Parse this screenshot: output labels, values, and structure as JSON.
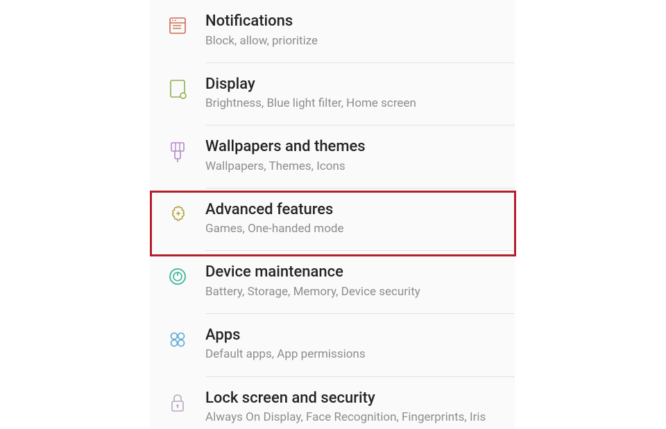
{
  "settings": {
    "items": [
      {
        "title": "Notifications",
        "sub": "Block, allow, prioritize",
        "icon": "notifications-icon"
      },
      {
        "title": "Display",
        "sub": "Brightness, Blue light filter, Home screen",
        "icon": "display-icon"
      },
      {
        "title": "Wallpapers and themes",
        "sub": "Wallpapers, Themes, Icons",
        "icon": "wallpapers-icon"
      },
      {
        "title": "Advanced features",
        "sub": "Games, One-handed mode",
        "icon": "advanced-icon",
        "highlighted": true
      },
      {
        "title": "Device maintenance",
        "sub": "Battery, Storage, Memory, Device security",
        "icon": "maintenance-icon"
      },
      {
        "title": "Apps",
        "sub": "Default apps, App permissions",
        "icon": "apps-icon"
      },
      {
        "title": "Lock screen and security",
        "sub": "Always On Display, Face Recognition, Fingerprints, Iris",
        "icon": "lock-icon"
      }
    ]
  },
  "colors": {
    "notifications": "#d06a54",
    "display": "#8fb04a",
    "wallpapers": "#b388c9",
    "advanced": "#b3a23a",
    "maintenance": "#3ab59a",
    "apps": "#5aa8d6",
    "lock": "#b8a7c4",
    "highlight": "#b3202c"
  }
}
